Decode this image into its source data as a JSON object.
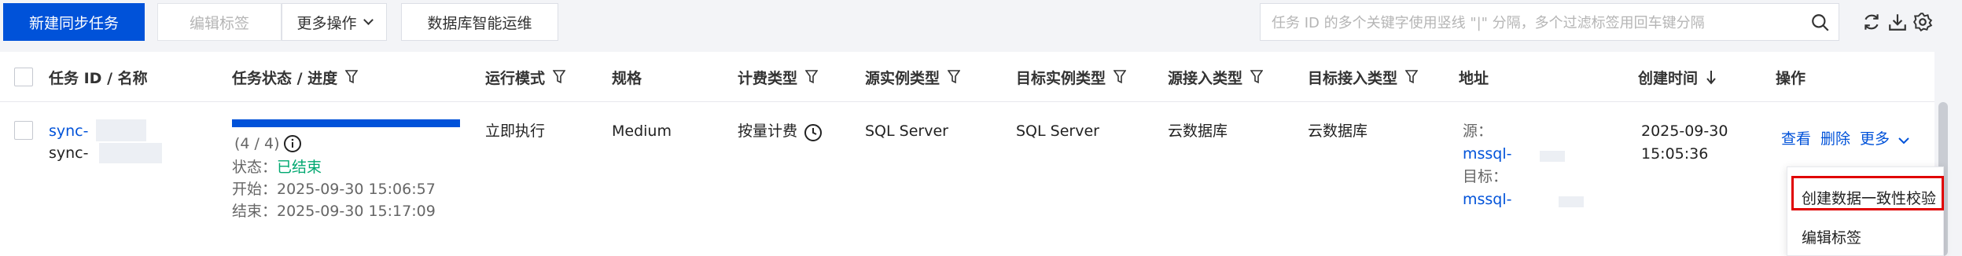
{
  "toolbar": {
    "new_task": "新建同步任务",
    "edit_tags": "编辑标签",
    "more_actions": "更多操作",
    "db_ops": "数据库智能运维",
    "search_placeholder": "任务 ID 的多个关键字使用竖线 \"|\" 分隔，多个过滤标签用回车键分隔",
    "icons": [
      "search-icon",
      "refresh-icon",
      "download-icon",
      "settings-icon"
    ]
  },
  "table": {
    "headers": {
      "task": "任务 ID / 名称",
      "status": "任务状态 / 进度",
      "mode": "运行模式",
      "spec": "规格",
      "billing": "计费类型",
      "source_type": "源实例类型",
      "target_type": "目标实例类型",
      "source_access": "源接入类型",
      "target_access": "目标接入类型",
      "address": "地址",
      "created": "创建时间",
      "actions": "操作"
    },
    "row": {
      "task_id": "sync-",
      "task_name": "sync-",
      "progress_text": "(4 / 4)",
      "progress": 1.0,
      "status_label": "状态：",
      "status_value": "已结束",
      "start": "开始：2025-09-30 15:06:57",
      "end": "结束：2025-09-30 15:17:09",
      "mode": "立即执行",
      "spec": "Medium",
      "billing": "按量计费",
      "source_type": "SQL Server",
      "target_type": "SQL Server",
      "source_access": "云数据库",
      "target_access": "云数据库",
      "source_label": "源：",
      "source_addr": "mssql-",
      "target_label": "目标：",
      "target_addr": "mssql-",
      "created_date": "2025-09-30",
      "created_time": "15:05:36",
      "view": "查看",
      "delete": "删除",
      "more": "更多"
    }
  },
  "dropdown": {
    "items": [
      "创建数据一致性校验",
      "编辑标签"
    ]
  },
  "colors": {
    "primary": "#0052d9",
    "success": "#00a870",
    "highlight": "#e00000"
  }
}
